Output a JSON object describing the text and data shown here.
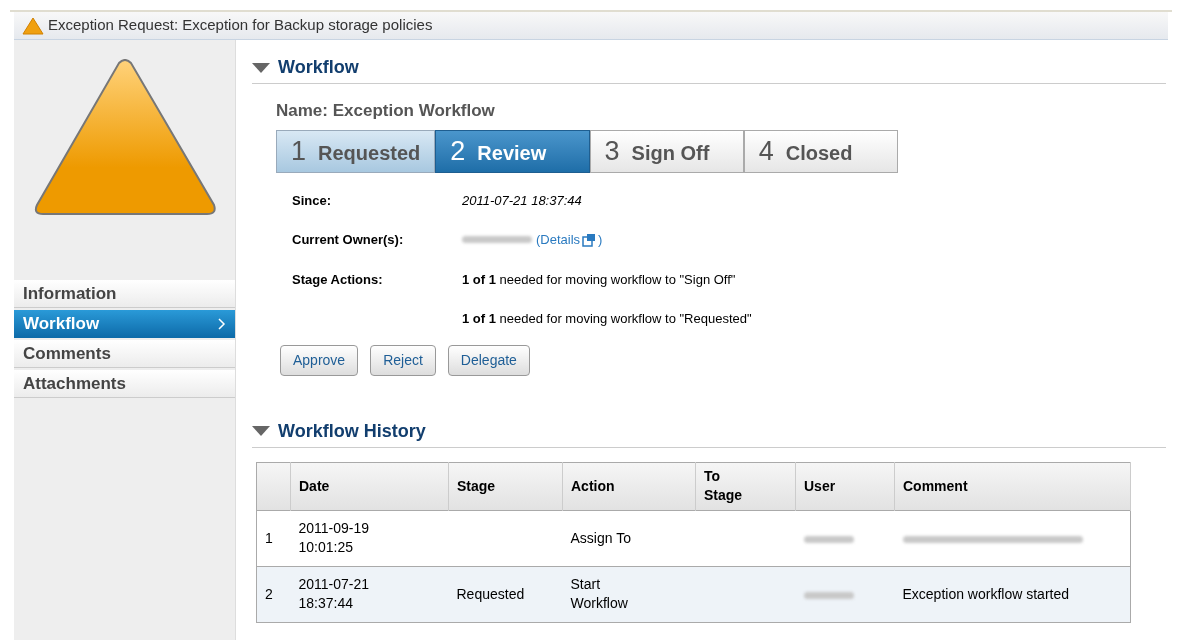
{
  "window": {
    "title": "Exception Request: Exception for Backup storage policies"
  },
  "sidebar": {
    "items": [
      {
        "label": "Information",
        "selected": false
      },
      {
        "label": "Workflow",
        "selected": true
      },
      {
        "label": "Comments",
        "selected": false
      },
      {
        "label": "Attachments",
        "selected": false
      }
    ]
  },
  "workflow": {
    "heading": "Workflow",
    "expanded": true,
    "name": "Name: Exception Workflow",
    "steps": [
      {
        "number": "1",
        "label": "Requested",
        "done": true,
        "selected": false
      },
      {
        "number": "2",
        "label": "Review",
        "done": false,
        "selected": true
      },
      {
        "number": "3",
        "label": "Sign Off",
        "done": false,
        "selected": false
      },
      {
        "number": "4",
        "label": "Closed",
        "done": false,
        "selected": false
      }
    ],
    "since_label": "Since:",
    "since": "2011-07-21 18:37:44",
    "owner_label": "Current Owner(s):",
    "owner_blurred": true,
    "details_link": "(Details",
    "details_end": ")",
    "actions_label": "Stage Actions:",
    "actions": [
      "**1 of 1** needed for moving workflow to \"Sign Off\"",
      "**1 of 1** needed for moving workflow to \"Requested\""
    ],
    "buttons": [
      "Approve",
      "Reject",
      "Delegate"
    ]
  },
  "history": {
    "heading": "Workflow History",
    "expanded": true,
    "columns": [
      "Date",
      "Stage",
      "Action",
      "To Stage",
      "User",
      "Comment"
    ],
    "rows": [
      {
        "index": "1",
        "date": "2011-09-19 10:01:25",
        "stage": "",
        "action": "Assign To",
        "to_stage": "",
        "user_blurred": true,
        "comment": "",
        "comment_blurred": true
      },
      {
        "index": "2",
        "date": "2011-07-21 18:37:44",
        "stage": "Requested",
        "action": "Start Workflow",
        "to_stage": "",
        "user_blurred": true,
        "comment": "Exception workflow started",
        "comment_blurred": false
      }
    ]
  }
}
